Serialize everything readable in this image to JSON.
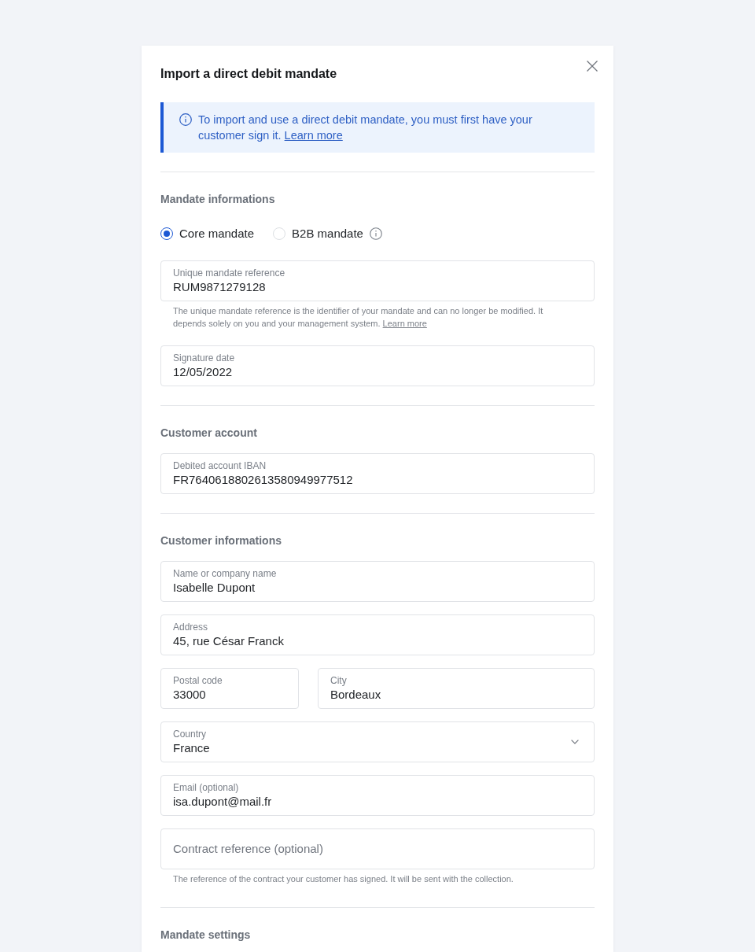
{
  "dialog": {
    "title": "Import a direct debit mandate"
  },
  "info_banner": {
    "text": "To import and use a direct debit mandate, you must first have your customer sign it.",
    "link": "Learn more"
  },
  "sections": [
    {
      "title": "Mandate informations",
      "items": [
        {
          "kind": "radio_group",
          "options": [
            {
              "label": "Core mandate",
              "selected": true,
              "info_icon": false
            },
            {
              "label": "B2B mandate",
              "selected": false,
              "info_icon": true
            }
          ]
        },
        {
          "kind": "field",
          "label": "Unique mandate reference",
          "value": "RUM9871279128",
          "help": "The unique mandate reference is the identifier of your mandate and can no longer be modified. It depends solely on you and your management system.",
          "help_link": "Learn more"
        },
        {
          "kind": "field",
          "label": "Signature date",
          "value": "12/05/2022"
        }
      ]
    },
    {
      "title": "Customer account",
      "items": [
        {
          "kind": "field",
          "label": "Debited account IBAN",
          "value": "FR7640618802613580949977512"
        }
      ]
    },
    {
      "title": "Customer informations",
      "items": [
        {
          "kind": "field",
          "label": "Name or company name",
          "value": "Isabelle Dupont"
        },
        {
          "kind": "field",
          "label": "Address",
          "value": "45, rue César Franck"
        },
        {
          "kind": "field_row",
          "fields": [
            {
              "kind": "field",
              "label": "Postal code",
              "value": "33000"
            },
            {
              "kind": "field",
              "label": "City",
              "value": "Bordeaux"
            }
          ]
        },
        {
          "kind": "select",
          "label": "Country",
          "value": "France"
        },
        {
          "kind": "field",
          "label": "Email (optional)",
          "value": "isa.dupont@mail.fr"
        },
        {
          "kind": "field",
          "placeholder": "Contract reference (optional)",
          "help": "The reference of the contract your customer has signed. It will be sent with the collection."
        }
      ]
    },
    {
      "title": "Mandate settings"
    }
  ]
}
